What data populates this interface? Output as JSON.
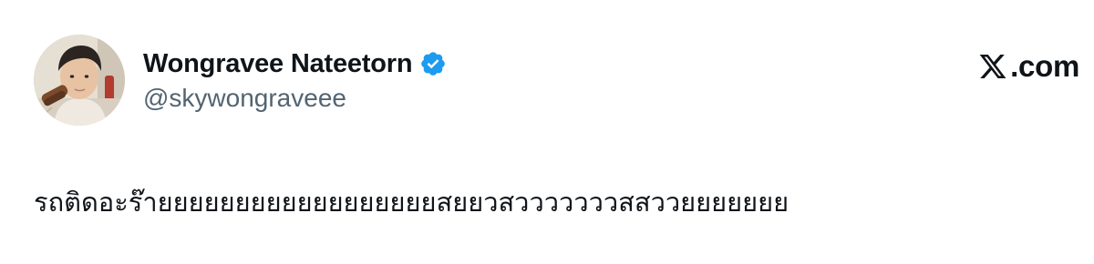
{
  "author": {
    "display_name": "Wongravee Nateetorn",
    "handle": "@skywongraveee",
    "verified": true,
    "verified_badge_color": "#1d9bf0"
  },
  "brand": {
    "label": ".com",
    "logo_icon": "x-logo-icon"
  },
  "tweet": {
    "text": "รถติดอะร๊ายยยยยยยยยยยยยยยยยยสยยวสวววววววสสววยยยยยยย"
  },
  "colors": {
    "text_primary": "#0f1419",
    "text_secondary": "#536471",
    "background": "#ffffff"
  }
}
